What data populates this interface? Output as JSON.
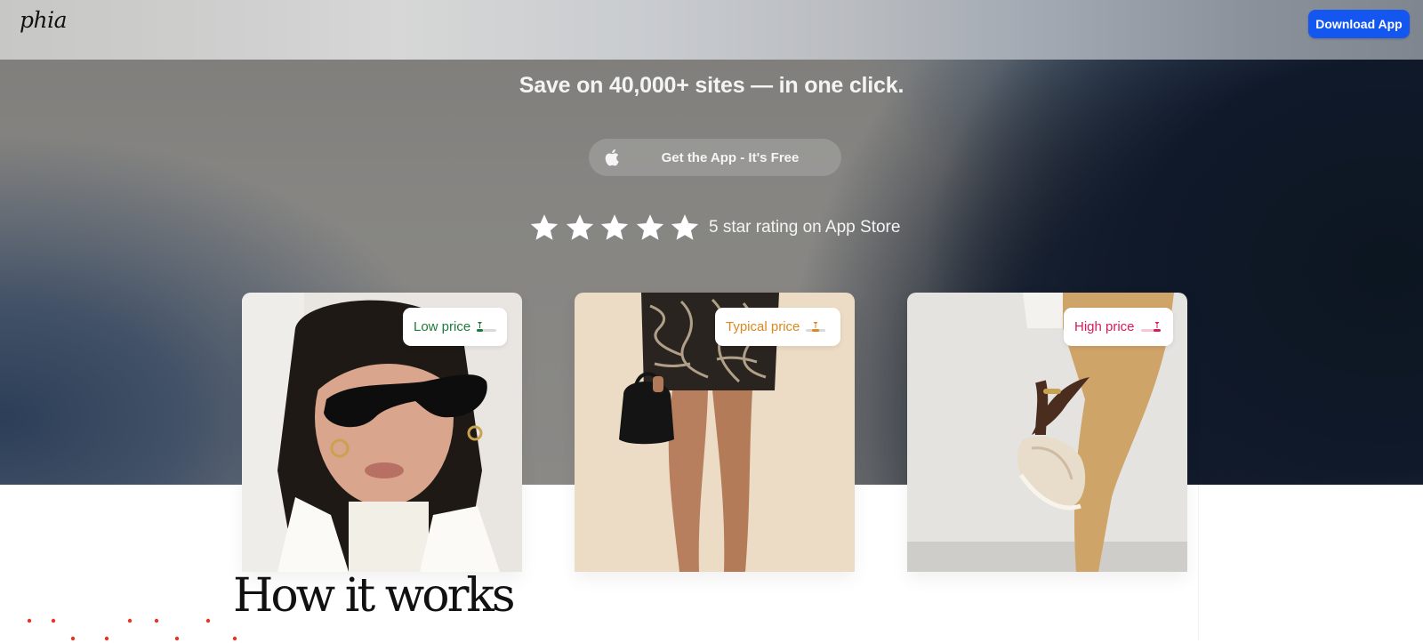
{
  "brand": {
    "logo_text": "phia"
  },
  "nav": {
    "download_label": "Download App",
    "accent_color": "#1456f0"
  },
  "hero": {
    "headline": "Save on 40,000+ sites — in one click.",
    "cta_label": "Get the App - It's Free",
    "cta_icon": "apple-icon",
    "rating": {
      "stars": 5,
      "text": "5 star rating on App Store"
    }
  },
  "cards": [
    {
      "badge": "Low price",
      "badge_color": "#1f7a3a",
      "image": "woman-sunglasses"
    },
    {
      "badge": "Typical price",
      "badge_color": "#d9891f",
      "image": "skirt-handbag"
    },
    {
      "badge": "High price",
      "badge_color": "#d81b5a",
      "image": "trousers-sneaker"
    }
  ],
  "section": {
    "title": "How it works",
    "dot_color": "#e0362b"
  }
}
